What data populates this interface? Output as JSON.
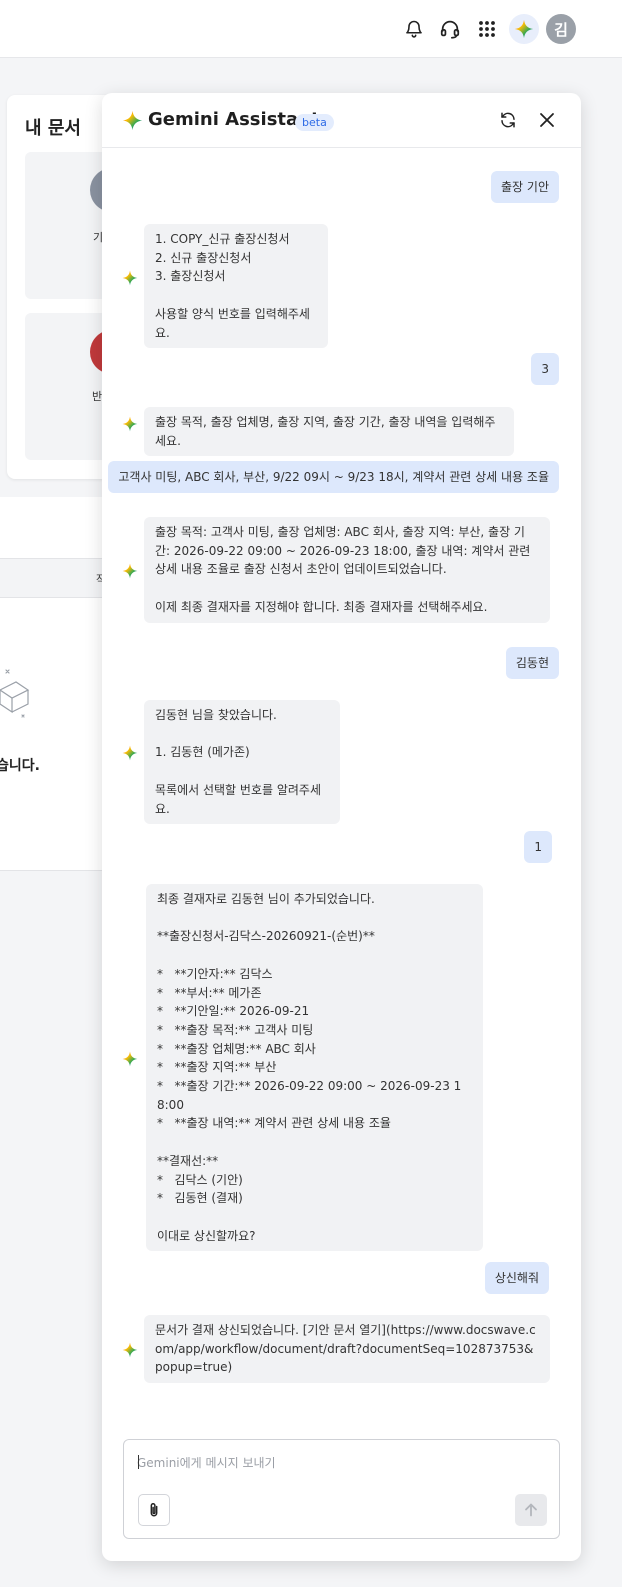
{
  "topbar": {
    "avatar_initial": "김",
    "icons": [
      "bell-icon",
      "headset-icon",
      "apps-grid-icon",
      "gemini-icon"
    ]
  },
  "background": {
    "my_docs_title": "내 문서",
    "tile1_label": "기",
    "tile2_label": "반",
    "table_header_partial": "작",
    "empty_message_partial": "습니다."
  },
  "assistant": {
    "title": "Gemini Assistant",
    "badge": "beta",
    "messages": [
      {
        "role": "user",
        "text": "출장 기안"
      },
      {
        "role": "bot",
        "text": "1. COPY_신규 출장신청서\n2. 신규 출장신청서\n3. 출장신청서\n\n사용할 양식 번호를 입력해주세요."
      },
      {
        "role": "user",
        "text": "3"
      },
      {
        "role": "bot",
        "text": "출장 목적, 출장 업체명, 출장 지역, 출장 기간, 출장 내역을 입력해주세요."
      },
      {
        "role": "user",
        "text": "고객사 미팅, ABC 회사, 부산, 9/22 09시 ~ 9/23 18시, 계약서 관련 상세 내용 조율"
      },
      {
        "role": "bot",
        "text": "출장 목적: 고객사 미팅, 출장 업체명: ABC 회사, 출장 지역: 부산, 출장 기간: 2026-09-22 09:00 ~ 2026-09-23 18:00, 출장 내역: 계약서 관련 상세 내용 조율로 출장 신청서 초안이 업데이트되었습니다.\n\n이제 최종 결재자를 지정해야 합니다. 최종 결재자를 선택해주세요."
      },
      {
        "role": "user",
        "text": "김동현"
      },
      {
        "role": "bot",
        "text": "김동현 님을 찾았습니다.\n\n1. 김동현 (메가존)\n\n목록에서 선택할 번호를 알려주세요."
      },
      {
        "role": "user",
        "text": "1"
      },
      {
        "role": "bot",
        "text": "최종 결재자로 김동현 님이 추가되었습니다.\n\n**출장신청서-김닥스-20260921-(순번)**\n\n*   **기안자:** 김닥스\n*   **부서:** 메가존\n*   **기안일:** 2026-09-21\n*   **출장 목적:** 고객사 미팅\n*   **출장 업체명:** ABC 회사\n*   **출장 지역:** 부산\n*   **출장 기간:** 2026-09-22 09:00 ~ 2026-09-23 18:00\n*   **출장 내역:** 계약서 관련 상세 내용 조율\n\n**결재선:**\n*   김닥스 (기안)\n*   김동현 (결재)\n\n이대로 상신할까요?"
      },
      {
        "role": "user",
        "text": "상신해줘"
      },
      {
        "role": "bot",
        "text": "문서가 결재 상신되었습니다. [기안 문서 열기](https://www.docswave.com/app/workflow/document/draft?documentSeq=102873753&popup=true)"
      }
    ],
    "composer": {
      "placeholder": "Gemini에게 메시지 보내기",
      "value": ""
    }
  },
  "colors": {
    "user_bubble": "#dde8fc",
    "bot_bubble": "#f1f2f4",
    "beta_text": "#2e6be6",
    "beta_bg": "#e3ecfd"
  }
}
